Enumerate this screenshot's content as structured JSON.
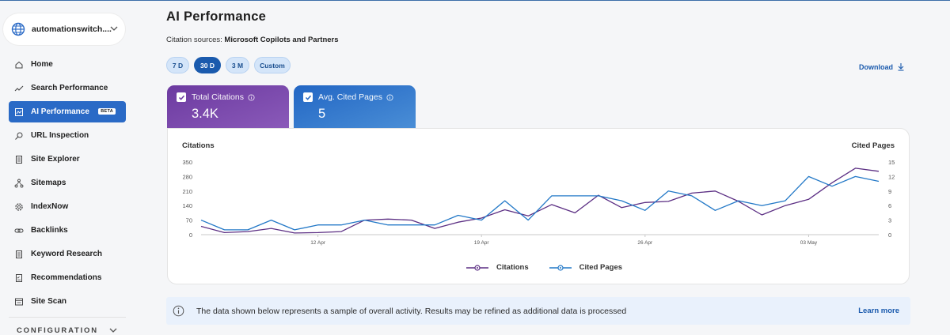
{
  "site": {
    "name": "automationswitch...."
  },
  "sidebar": {
    "items": [
      {
        "label": "Home",
        "icon": "home-icon"
      },
      {
        "label": "Search Performance",
        "icon": "trend-icon"
      },
      {
        "label": "AI Performance",
        "icon": "ai-icon",
        "badge": "BETA",
        "active": true
      },
      {
        "label": "URL Inspection",
        "icon": "inspect-icon"
      },
      {
        "label": "Site Explorer",
        "icon": "document-icon"
      },
      {
        "label": "Sitemaps",
        "icon": "sitemap-icon"
      },
      {
        "label": "IndexNow",
        "icon": "gear-icon"
      },
      {
        "label": "Backlinks",
        "icon": "link-icon"
      },
      {
        "label": "Keyword Research",
        "icon": "document-icon"
      },
      {
        "label": "Recommendations",
        "icon": "list-icon"
      },
      {
        "label": "Site Scan",
        "icon": "scan-icon"
      }
    ],
    "config_label": "CONFIGURATION"
  },
  "main": {
    "title": "AI Performance",
    "citation_prefix": "Citation sources:",
    "citation_sources": "Microsoft Copilots and Partners",
    "ranges": [
      "7 D",
      "30 D",
      "3 M",
      "Custom"
    ],
    "active_range": "30 D",
    "download_label": "Download"
  },
  "metrics": {
    "citations": {
      "label": "Total Citations",
      "value": "3.4K"
    },
    "cited_pages": {
      "label": "Avg. Cited Pages",
      "value": "5"
    }
  },
  "banner": {
    "message": "The data shown below represents a sample of overall activity. Results may be refined as additional data is processed",
    "link": "Learn more"
  },
  "colors": {
    "citations": "#5b2e83",
    "cited_pages": "#2278c7",
    "active_nav": "#2a6ac6"
  },
  "chart_data": {
    "type": "line",
    "left_axis_title": "Citations",
    "right_axis_title": "Cited Pages",
    "left_ticks": [
      "350",
      "280",
      "210",
      "140",
      "70",
      "0"
    ],
    "right_ticks": [
      "15",
      "12",
      "9",
      "6",
      "3",
      "0"
    ],
    "left_ylim": [
      0,
      350
    ],
    "right_ylim": [
      0,
      15
    ],
    "x_labels": [
      {
        "label": "12 Apr",
        "index": 5
      },
      {
        "label": "19 Apr",
        "index": 12
      },
      {
        "label": "26 Apr",
        "index": 19
      },
      {
        "label": "03 May",
        "index": 26
      }
    ],
    "series": [
      {
        "name": "Citations",
        "axis": "left",
        "values": [
          40,
          10,
          15,
          30,
          8,
          10,
          15,
          70,
          75,
          70,
          30,
          60,
          80,
          120,
          90,
          145,
          105,
          190,
          130,
          155,
          160,
          200,
          210,
          160,
          95,
          140,
          170,
          250,
          320,
          305
        ]
      },
      {
        "name": "Cited Pages",
        "axis": "right",
        "values": [
          3,
          1,
          1,
          3,
          1,
          2,
          2,
          3,
          2,
          2,
          2,
          4,
          3,
          7,
          3,
          8,
          8,
          8,
          7,
          5,
          9,
          8,
          5,
          7,
          6,
          7,
          12,
          10,
          12,
          11
        ]
      }
    ],
    "grid": false,
    "legend": "bottom-center"
  }
}
